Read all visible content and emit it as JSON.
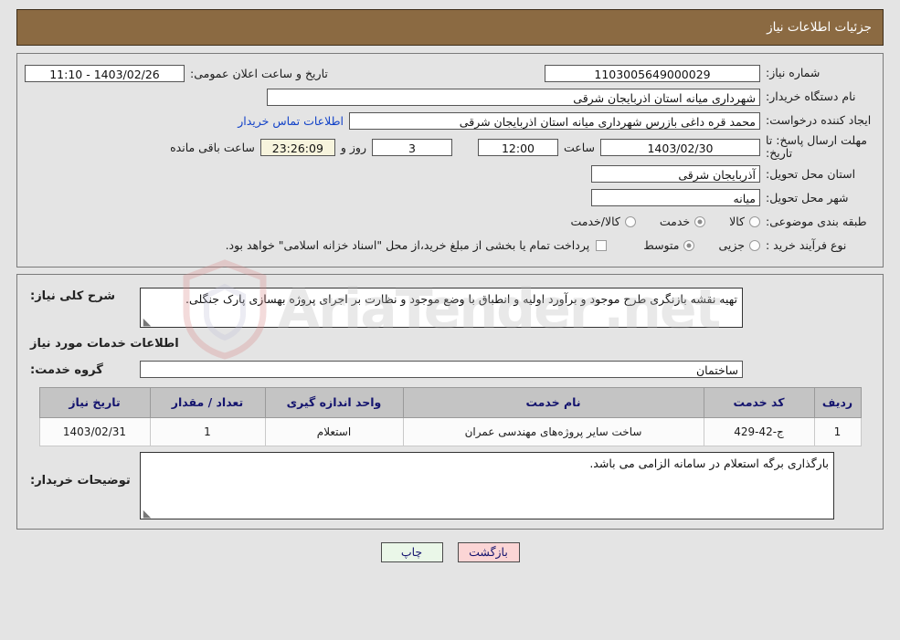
{
  "header": {
    "title": "جزئیات اطلاعات نیاز"
  },
  "top_form": {
    "need_number": {
      "label": "شماره نیاز:",
      "value": "1103005649000029"
    },
    "public_announce": {
      "label": "تاریخ و ساعت اعلان عمومی:",
      "value": "1403/02/26 - 11:10"
    },
    "buyer_org": {
      "label": "نام دستگاه خریدار:",
      "value": "شهرداری میانه استان اذربایجان شرقی"
    },
    "request_creator": {
      "label": "ایجاد کننده درخواست:",
      "value": "محمد قره داغی بازرس شهرداری میانه استان اذربایجان شرقی"
    },
    "contact_link": "اطلاعات تماس خریدار",
    "deadline": {
      "label": "مهلت ارسال پاسخ: تا تاریخ:",
      "date": "1403/02/30",
      "hour_label": "ساعت",
      "hour": "12:00",
      "days": "3",
      "days_label": "روز و",
      "countdown": "23:26:09",
      "remaining_label": "ساعت باقی مانده"
    },
    "province": {
      "label": "استان محل تحویل:",
      "value": "آذربایجان شرقی"
    },
    "city": {
      "label": "شهر محل تحویل:",
      "value": "میانه"
    },
    "category": {
      "label": "طبقه بندی موضوعی:",
      "options": [
        "کالا",
        "خدمت",
        "کالا/خدمت"
      ],
      "selected": "خدمت"
    },
    "purchase_type": {
      "label": "نوع فرآیند خرید :",
      "options": [
        "جزیی",
        "متوسط"
      ],
      "selected": "متوسط",
      "treasury_note": "پرداخت تمام یا بخشی از مبلغ خرید،از محل \"اسناد خزانه اسلامی\" خواهد بود.",
      "treasury_checked": false
    }
  },
  "middle": {
    "description": {
      "label": "شرح کلی نیاز:",
      "value": "تهیه نقشه بازنگری طرح موجود و برآورد اولیه و انطباق با وضع موجود و نظارت بر اجرای پروژه بهسازی پارک جنگلی."
    },
    "services_heading": "اطلاعات خدمات مورد نیاز",
    "service_group": {
      "label": "گروه خدمت:",
      "value": "ساختمان"
    },
    "table": {
      "columns": [
        "ردیف",
        "کد خدمت",
        "نام خدمت",
        "واحد اندازه گیری",
        "تعداد / مقدار",
        "تاریخ نیاز"
      ],
      "rows": [
        {
          "radif": "1",
          "code": "ج-42-429",
          "name": "ساخت سایر پروژه‌های مهندسی عمران",
          "unit": "استعلام",
          "qty": "1",
          "date": "1403/02/31"
        }
      ]
    },
    "buyer_notes": {
      "label": "توضیحات خریدار:",
      "value": "بارگذاری برگه استعلام در سامانه الزامی می باشد."
    }
  },
  "footer": {
    "print_label": "چاپ",
    "back_label": "بازگشت"
  },
  "watermark": {
    "text": "AriaTender",
    "suffix": ".net"
  },
  "colors": {
    "header_bg": "#8b6a42",
    "link": "#1242c8",
    "table_header_text": "#14146e",
    "service_name": "#1f6b2a",
    "back_button": "#fbd5d5",
    "print_button": "#eaf7e8",
    "countdown_bg": "#f7f4dd"
  }
}
